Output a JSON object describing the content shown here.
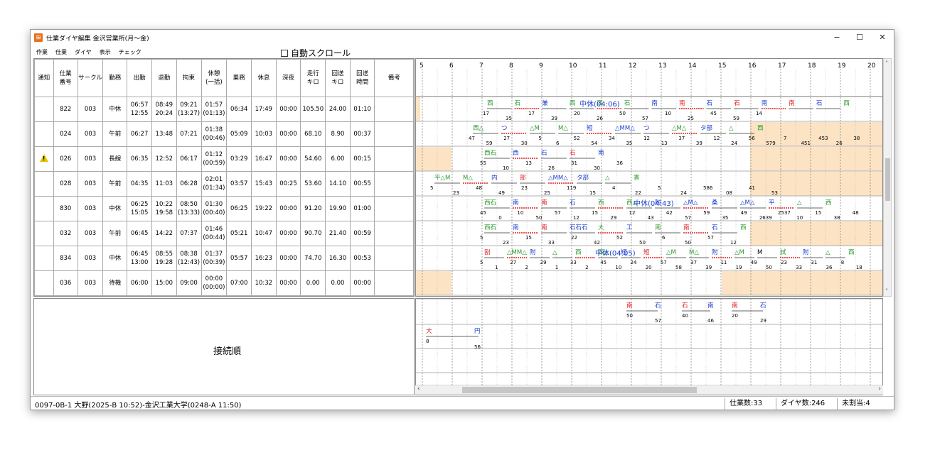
{
  "window": {
    "title": "仕業ダイヤ編集 金沢営業所(月～金)",
    "minimize": "−",
    "maximize": "☐",
    "close": "✕"
  },
  "menu": [
    "作業",
    "仕業",
    "ダイヤ",
    "表示",
    "チェック"
  ],
  "autoscroll_label": "自動スクロール",
  "table": {
    "headers": [
      "通知",
      "仕業\n番号",
      "サークル",
      "勤務",
      "出勤",
      "退勤",
      "拘束",
      "休憩\n(一括)",
      "乗務",
      "休息",
      "深夜",
      "走行\nキロ",
      "回送\nキロ",
      "回送\n時間",
      "備考"
    ],
    "rows": [
      {
        "notice": "",
        "no": "822",
        "circle": "003",
        "duty": "中休",
        "in": "06:57\n12:55",
        "out": "08:49\n20:24",
        "bind": "09:21\n(13:27)",
        "rest": "01:57\n(01:13)",
        "ride": "06:34",
        "repose": "17:49",
        "night": "00:00",
        "km": "105.50",
        "dkm": "24.00",
        "dtime": "01:10",
        "note": ""
      },
      {
        "notice": "",
        "no": "024",
        "circle": "003",
        "duty": "午前",
        "in": "06:27",
        "out": "13:48",
        "bind": "07:21",
        "rest": "01:38\n(00:46)",
        "ride": "05:09",
        "repose": "10:03",
        "night": "00:00",
        "km": "68.10",
        "dkm": "8.90",
        "dtime": "00:37",
        "note": ""
      },
      {
        "notice": "warning",
        "no": "026",
        "circle": "003",
        "duty": "長線",
        "in": "06:35",
        "out": "12:52",
        "bind": "06:17",
        "rest": "01:12\n(00:59)",
        "ride": "03:29",
        "repose": "16:47",
        "night": "00:00",
        "km": "54.60",
        "dkm": "6.00",
        "dtime": "00:15",
        "note": ""
      },
      {
        "notice": "",
        "no": "028",
        "circle": "003",
        "duty": "午前",
        "in": "04:35",
        "out": "11:03",
        "bind": "06:28",
        "rest": "02:01\n(01:34)",
        "ride": "03:57",
        "repose": "15:43",
        "night": "00:25",
        "km": "53.60",
        "dkm": "14.10",
        "dtime": "00:55",
        "note": ""
      },
      {
        "notice": "",
        "no": "830",
        "circle": "003",
        "duty": "中休",
        "in": "06:25\n15:05",
        "out": "10:22\n19:58",
        "bind": "08:50\n(13:33)",
        "rest": "01:30\n(00:40)",
        "ride": "06:25",
        "repose": "19:22",
        "night": "00:00",
        "km": "91.20",
        "dkm": "19.90",
        "dtime": "01:00",
        "note": ""
      },
      {
        "notice": "",
        "no": "032",
        "circle": "003",
        "duty": "午前",
        "in": "06:45",
        "out": "14:22",
        "bind": "07:37",
        "rest": "01:46\n(00:44)",
        "ride": "05:21",
        "repose": "10:47",
        "night": "00:00",
        "km": "90.70",
        "dkm": "21.40",
        "dtime": "00:59",
        "note": ""
      },
      {
        "notice": "",
        "no": "834",
        "circle": "003",
        "duty": "中休",
        "in": "06:45\n13:00",
        "out": "08:55\n19:28",
        "bind": "08:38\n(12:43)",
        "rest": "01:37\n(00:39)",
        "ride": "05:57",
        "repose": "16:23",
        "night": "00:00",
        "km": "74.70",
        "dkm": "16.30",
        "dtime": "00:53",
        "note": ""
      },
      {
        "notice": "",
        "no": "036",
        "circle": "003",
        "duty": "待機",
        "in": "06:00",
        "out": "15:00",
        "bind": "09:00",
        "rest": "00:00\n(00:00)",
        "ride": "07:00",
        "repose": "10:32",
        "night": "00:00",
        "km": "0.00",
        "dkm": "0.00",
        "dtime": "00:00",
        "note": ""
      }
    ]
  },
  "timeline": {
    "hours": [
      "5",
      "6",
      "7",
      "8",
      "9",
      "10",
      "11",
      "12",
      "13",
      "14",
      "15",
      "16",
      "17",
      "18",
      "19",
      "20"
    ],
    "midday_rest_labels": [
      {
        "row": 0,
        "text": "中休(04:06)"
      },
      {
        "row": 4,
        "text": "中休(04:43)"
      },
      {
        "row": 6,
        "text": "中休(04:05)"
      }
    ],
    "row_tokens": [
      [
        {
          "t": "西",
          "c": "#2a9a2a"
        },
        {
          "t": "石",
          "c": "#2a9a2a"
        },
        {
          "t": "兼",
          "c": "#1a3fd0"
        },
        {
          "t": "西",
          "c": "#2a9a2a"
        },
        {
          "t": "西",
          "c": "#2a9a2a"
        },
        {
          "t": "石",
          "c": "#2a9a2a"
        },
        {
          "t": "南",
          "c": "#1a3fd0"
        },
        {
          "t": "南",
          "c": "#e02020"
        },
        {
          "t": "石",
          "c": "#1a3fd0"
        },
        {
          "t": "石",
          "c": "#e02020"
        },
        {
          "t": "南",
          "c": "#1a3fd0"
        },
        {
          "t": "南",
          "c": "#e02020"
        },
        {
          "t": "石",
          "c": "#1a3fd0"
        },
        {
          "t": "西",
          "c": "#2a9a2a"
        }
      ],
      [
        {
          "t": "西△",
          "c": "#2a9a2a"
        },
        {
          "t": "つ",
          "c": "#1a3fd0"
        },
        {
          "t": "△M",
          "c": "#2a9a2a"
        },
        {
          "t": "M△",
          "c": "#2a9a2a"
        },
        {
          "t": "短",
          "c": "#1a3fd0"
        },
        {
          "t": "△MM△",
          "c": "#1a3fd0"
        },
        {
          "t": "つ",
          "c": "#1a3fd0"
        },
        {
          "t": "△M△",
          "c": "#2a9a2a"
        },
        {
          "t": "タ部",
          "c": "#1a3fd0"
        },
        {
          "t": "△",
          "c": "#2a9a2a"
        },
        {
          "t": "西",
          "c": "#2a9a2a"
        }
      ],
      [
        {
          "t": "西石",
          "c": "#2a9a2a"
        },
        {
          "t": "西",
          "c": "#1a3fd0"
        },
        {
          "t": "石",
          "c": "#1a3fd0"
        },
        {
          "t": "石",
          "c": "#e02020"
        },
        {
          "t": "南",
          "c": "#1a3fd0"
        }
      ],
      [
        {
          "t": "平△M",
          "c": "#2a9a2a"
        },
        {
          "t": "M△",
          "c": "#2a9a2a"
        },
        {
          "t": "内",
          "c": "#1a3fd0"
        },
        {
          "t": "部",
          "c": "#e02020"
        },
        {
          "t": "△MM△",
          "c": "#1a3fd0"
        },
        {
          "t": "タ部",
          "c": "#1a3fd0"
        },
        {
          "t": "△",
          "c": "#2a9a2a"
        },
        {
          "t": "香",
          "c": "#2a9a2a"
        }
      ],
      [
        {
          "t": "西石",
          "c": "#2a9a2a"
        },
        {
          "t": "南",
          "c": "#1a3fd0"
        },
        {
          "t": "南",
          "c": "#e02020"
        },
        {
          "t": "石",
          "c": "#1a3fd0"
        },
        {
          "t": "西",
          "c": "#2a9a2a"
        },
        {
          "t": "西△",
          "c": "#2a9a2a"
        },
        {
          "t": "附",
          "c": "#1a3fd0"
        },
        {
          "t": "△M△",
          "c": "#1a3fd0"
        },
        {
          "t": "桑",
          "c": "#1a3fd0"
        },
        {
          "t": "△M△",
          "c": "#1a3fd0"
        },
        {
          "t": "平",
          "c": "#1a3fd0"
        },
        {
          "t": "△",
          "c": "#2a9a2a"
        },
        {
          "t": "西",
          "c": "#2a9a2a"
        }
      ],
      [
        {
          "t": "西石",
          "c": "#2a9a2a"
        },
        {
          "t": "南",
          "c": "#1a3fd0"
        },
        {
          "t": "南",
          "c": "#e02020"
        },
        {
          "t": "石石石",
          "c": "#1a3fd0"
        },
        {
          "t": "大",
          "c": "#2a9a2a"
        },
        {
          "t": "工",
          "c": "#1a3fd0"
        },
        {
          "t": "南",
          "c": "#2a9a2a"
        },
        {
          "t": "南",
          "c": "#e02020"
        },
        {
          "t": "石",
          "c": "#1a3fd0"
        },
        {
          "t": "西",
          "c": "#2a9a2a"
        }
      ],
      [
        {
          "t": "割",
          "c": "#e02020"
        },
        {
          "t": "△MM△",
          "c": "#2a9a2a"
        },
        {
          "t": "附",
          "c": "#1a3fd0"
        },
        {
          "t": "△",
          "c": "#2a9a2a"
        },
        {
          "t": "西",
          "c": "#2a9a2a"
        },
        {
          "t": "西△",
          "c": "#2a9a2a"
        },
        {
          "t": "短",
          "c": "#1a3fd0"
        },
        {
          "t": "短",
          "c": "#e02020"
        },
        {
          "t": "△M",
          "c": "#2a9a2a"
        },
        {
          "t": "M△",
          "c": "#2a9a2a"
        },
        {
          "t": "附",
          "c": "#1a3fd0"
        },
        {
          "t": "△M",
          "c": "#2a9a2a"
        },
        {
          "t": "M",
          "c": "#000000"
        },
        {
          "t": "試",
          "c": "#2a9a2a"
        },
        {
          "t": "附",
          "c": "#1a3fd0"
        },
        {
          "t": "△",
          "c": "#2a9a2a"
        },
        {
          "t": "西",
          "c": "#2a9a2a"
        }
      ],
      []
    ],
    "row_minutes": [
      [
        "17",
        "35",
        "17",
        "39",
        "20",
        "26",
        "50",
        "57",
        "10",
        "25",
        "45",
        "59",
        "14"
      ],
      [
        "47",
        "59",
        "27",
        "30",
        "5",
        "6",
        "52",
        "54",
        "34",
        "35",
        "12",
        "13",
        "37",
        "39",
        "12",
        "24",
        "56",
        "579",
        "7",
        "451",
        "453",
        "26",
        "38"
      ],
      [
        "55",
        "10",
        "13",
        "26",
        "31",
        "30",
        "36"
      ],
      [
        "5",
        "23",
        "48",
        "49",
        "23",
        "25",
        "119",
        "15",
        "4",
        "22",
        "5",
        "24",
        "586",
        "08",
        "41",
        "53"
      ],
      [
        "45",
        "0",
        "10",
        "50",
        "57",
        "12",
        "15",
        "29",
        "12",
        "43",
        "42",
        "57",
        "59",
        "35",
        "49",
        "2639",
        "2537",
        "10",
        "15",
        "38",
        "48"
      ],
      [
        "5",
        "23",
        "15",
        "33",
        "22",
        "42",
        "52",
        "50",
        "6",
        "50",
        "57",
        "12"
      ],
      [
        "5",
        "1",
        "27",
        "2",
        "29",
        "1",
        "33",
        "2",
        "45",
        "10",
        "24",
        "20",
        "57",
        "58",
        "37",
        "39",
        "11",
        "19",
        "49",
        "50",
        "23",
        "33",
        "31",
        "36",
        "8",
        "18"
      ],
      []
    ]
  },
  "connection": {
    "label": "接続順",
    "tokens": [
      {
        "t": "南",
        "c": "#e02020"
      },
      {
        "t": "石",
        "c": "#1a3fd0"
      },
      {
        "t": "石",
        "c": "#e02020"
      },
      {
        "t": "南",
        "c": "#1a3fd0"
      },
      {
        "t": "南",
        "c": "#e02020"
      },
      {
        "t": "石",
        "c": "#1a3fd0"
      },
      {
        "t": "大",
        "c": "#e02020"
      },
      {
        "t": "円",
        "c": "#1a3fd0"
      }
    ],
    "minutes": [
      "50",
      "57",
      "40",
      "46",
      "20",
      "29",
      "8",
      "56"
    ],
    "hscroll_left": "‹",
    "hscroll_right": "›"
  },
  "status": {
    "left": "0097-0B-1 大野(2025-B 10:52)-金沢工業大学(0248-A 11:50)",
    "jobs": "仕業数:33",
    "diagrams": "ダイヤ数:246",
    "unassigned": "未割当:4"
  },
  "colors": {
    "idle_fill": "#fbe3c4",
    "red_line": "#e02020",
    "blue": "#1a3fd0",
    "green": "#2a9a2a"
  }
}
